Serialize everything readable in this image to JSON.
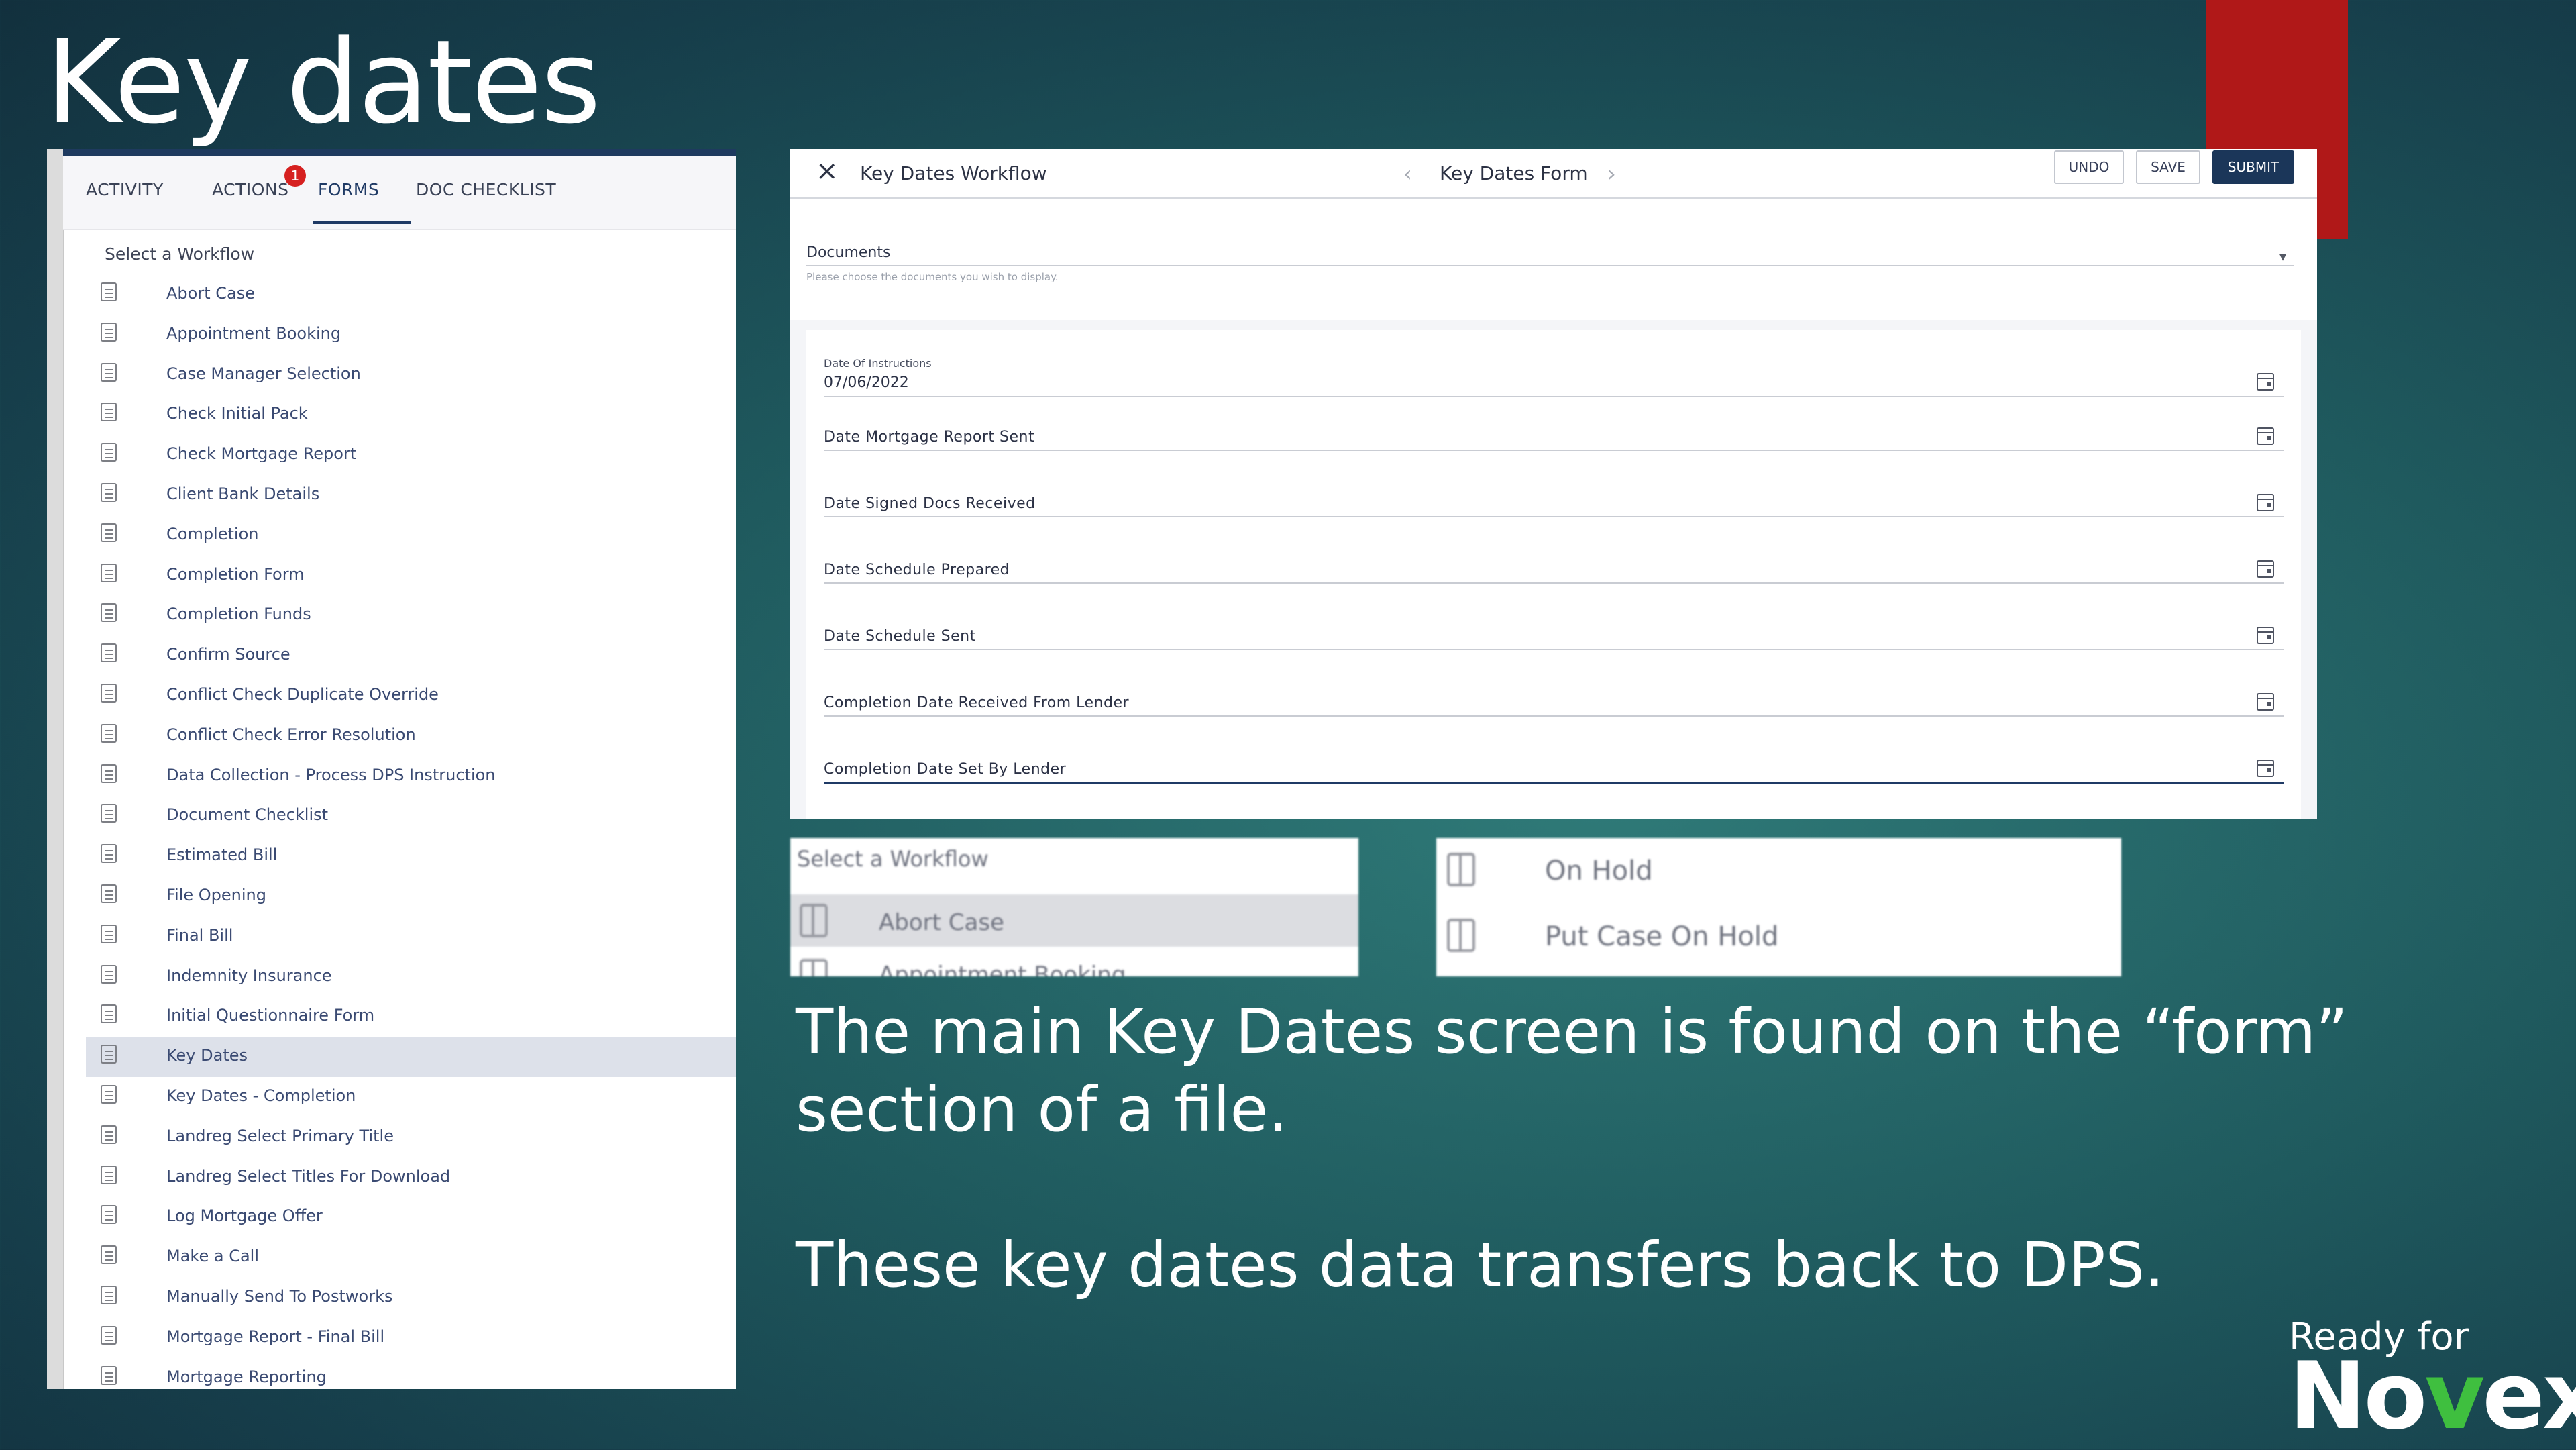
{
  "slide": {
    "title": "Key dates",
    "body_line1": "The main Key Dates screen is found on the “form”",
    "body_line2": "section of a file.",
    "body_line3": "These key dates data transfers back to DPS."
  },
  "left_panel": {
    "tabs": [
      {
        "label": "ACTIVITY"
      },
      {
        "label": "ACTIONS",
        "badge": "1"
      },
      {
        "label": "FORMS",
        "active": true
      },
      {
        "label": "DOC CHECKLIST"
      }
    ],
    "select_heading": "Select a Workflow",
    "workflows": [
      "Abort Case",
      "Appointment Booking",
      "Case Manager Selection",
      "Check Initial Pack",
      "Check Mortgage Report",
      "Client Bank Details",
      "Completion",
      "Completion Form",
      "Completion Funds",
      "Confirm Source",
      "Conflict Check Duplicate Override",
      "Conflict Check Error Resolution",
      "Data Collection - Process DPS Instruction",
      "Document Checklist",
      "Estimated Bill",
      "File Opening",
      "Final Bill",
      "Indemnity Insurance",
      "Initial Questionnaire Form",
      "Key Dates",
      "Key Dates - Completion",
      "Landreg Select Primary Title",
      "Landreg Select Titles For Download",
      "Log Mortgage Offer",
      "Make a Call",
      "Manually Send To Postworks",
      "Mortgage Report - Final Bill",
      "Mortgage Reporting"
    ],
    "selected_workflow": "Key Dates"
  },
  "form_panel": {
    "close_icon": "close-icon",
    "workflow_title": "Key Dates Workflow",
    "form_title": "Key Dates Form",
    "prev_icon": "chevron-left-icon",
    "next_icon": "chevron-right-icon",
    "buttons": {
      "undo": "UNDO",
      "save": "SAVE",
      "submit": "SUBMIT"
    },
    "documents": {
      "label": "Documents",
      "hint": "Please choose the documents you wish to display."
    },
    "date_fields": [
      {
        "label": "Date Of Instructions",
        "value": "07/06/2022"
      },
      {
        "label": "Date Mortgage Report Sent",
        "value": ""
      },
      {
        "label": "Date Signed Docs Received",
        "value": ""
      },
      {
        "label": "Date Schedule Prepared",
        "value": ""
      },
      {
        "label": "Date Schedule Sent",
        "value": ""
      },
      {
        "label": "Completion Date Received From Lender",
        "value": ""
      },
      {
        "label": "Completion Date Set By Lender",
        "value": ""
      }
    ]
  },
  "zoom_left": {
    "heading": "Select a Workflow",
    "items": [
      "Abort Case",
      "Appointment Booking"
    ]
  },
  "zoom_right": {
    "items": [
      "On Hold",
      "Put Case On Hold"
    ]
  },
  "logo": {
    "line1": "Ready for",
    "word_start": "No",
    "word_v": "v",
    "word_end": "ex"
  },
  "colors": {
    "accent_red": "#b01818",
    "navy": "#1b3659",
    "logo_green": "#3fbf3f"
  }
}
